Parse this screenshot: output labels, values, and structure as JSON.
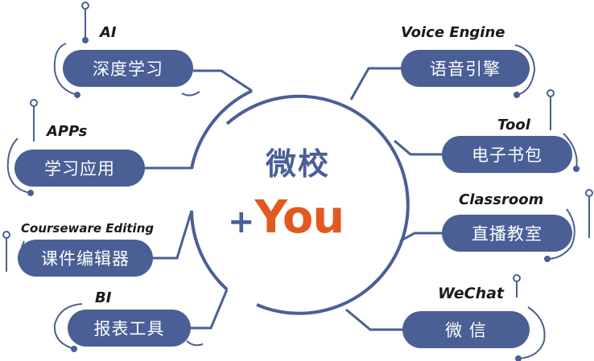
{
  "center": {
    "title": "微校",
    "plus": "+",
    "you": "You"
  },
  "colors": {
    "navy": "#4a5f96",
    "orange": "#e05a1f",
    "line": "#4a5f96"
  },
  "nodes": [
    {
      "key": "ai",
      "label": "深度学习",
      "tag": "AI"
    },
    {
      "key": "apps",
      "label": "学习应用",
      "tag": "APPs"
    },
    {
      "key": "courseware",
      "label": "课件编辑器",
      "tag": "Courseware Editing"
    },
    {
      "key": "bi",
      "label": "报表工具",
      "tag": "BI"
    },
    {
      "key": "voice",
      "label": "语音引擎",
      "tag": "Voice Engine"
    },
    {
      "key": "tool",
      "label": "电子书包",
      "tag": "Tool"
    },
    {
      "key": "classroom",
      "label": "直播教室",
      "tag": "Classroom"
    },
    {
      "key": "wechat",
      "label": "微 信",
      "tag": "WeChat"
    }
  ]
}
